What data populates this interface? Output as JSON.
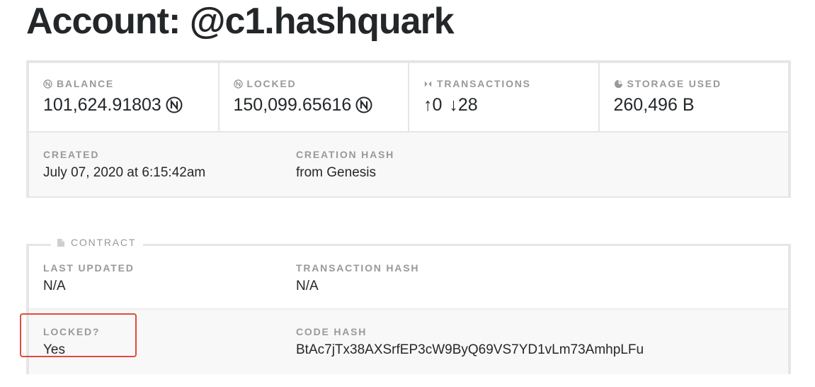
{
  "page": {
    "title": "Account: @c1.hashquark"
  },
  "overview": {
    "balance": {
      "label": "BALANCE",
      "value": "101,624.91803",
      "icon": "near-icon"
    },
    "locked": {
      "label": "LOCKED",
      "value": "150,099.65616",
      "icon": "near-icon"
    },
    "transactions": {
      "label": "TRANSACTIONS",
      "sent": "↑0",
      "received": "↓28",
      "icon": "transactions-icon"
    },
    "storage": {
      "label": "STORAGE USED",
      "value": "260,496 B",
      "icon": "storage-icon"
    },
    "created": {
      "label": "CREATED",
      "value": "July 07, 2020 at 6:15:42am"
    },
    "creation_hash": {
      "label": "CREATION HASH",
      "value": "from Genesis"
    }
  },
  "contract": {
    "legend": "CONTRACT",
    "last_updated": {
      "label": "LAST UPDATED",
      "value": "N/A"
    },
    "transaction_hash": {
      "label": "TRANSACTION HASH",
      "value": "N/A"
    },
    "locked": {
      "label": "LOCKED?",
      "value": "Yes"
    },
    "code_hash": {
      "label": "CODE HASH",
      "value": "BtAc7jTx38AXSrfEP3cW9ByQ69VS7YD1vLm73AmhpLFu"
    }
  },
  "colors": {
    "text": "#24272a",
    "muted": "#999999",
    "border": "#e6e6e6",
    "highlight": "#e44a3c"
  }
}
